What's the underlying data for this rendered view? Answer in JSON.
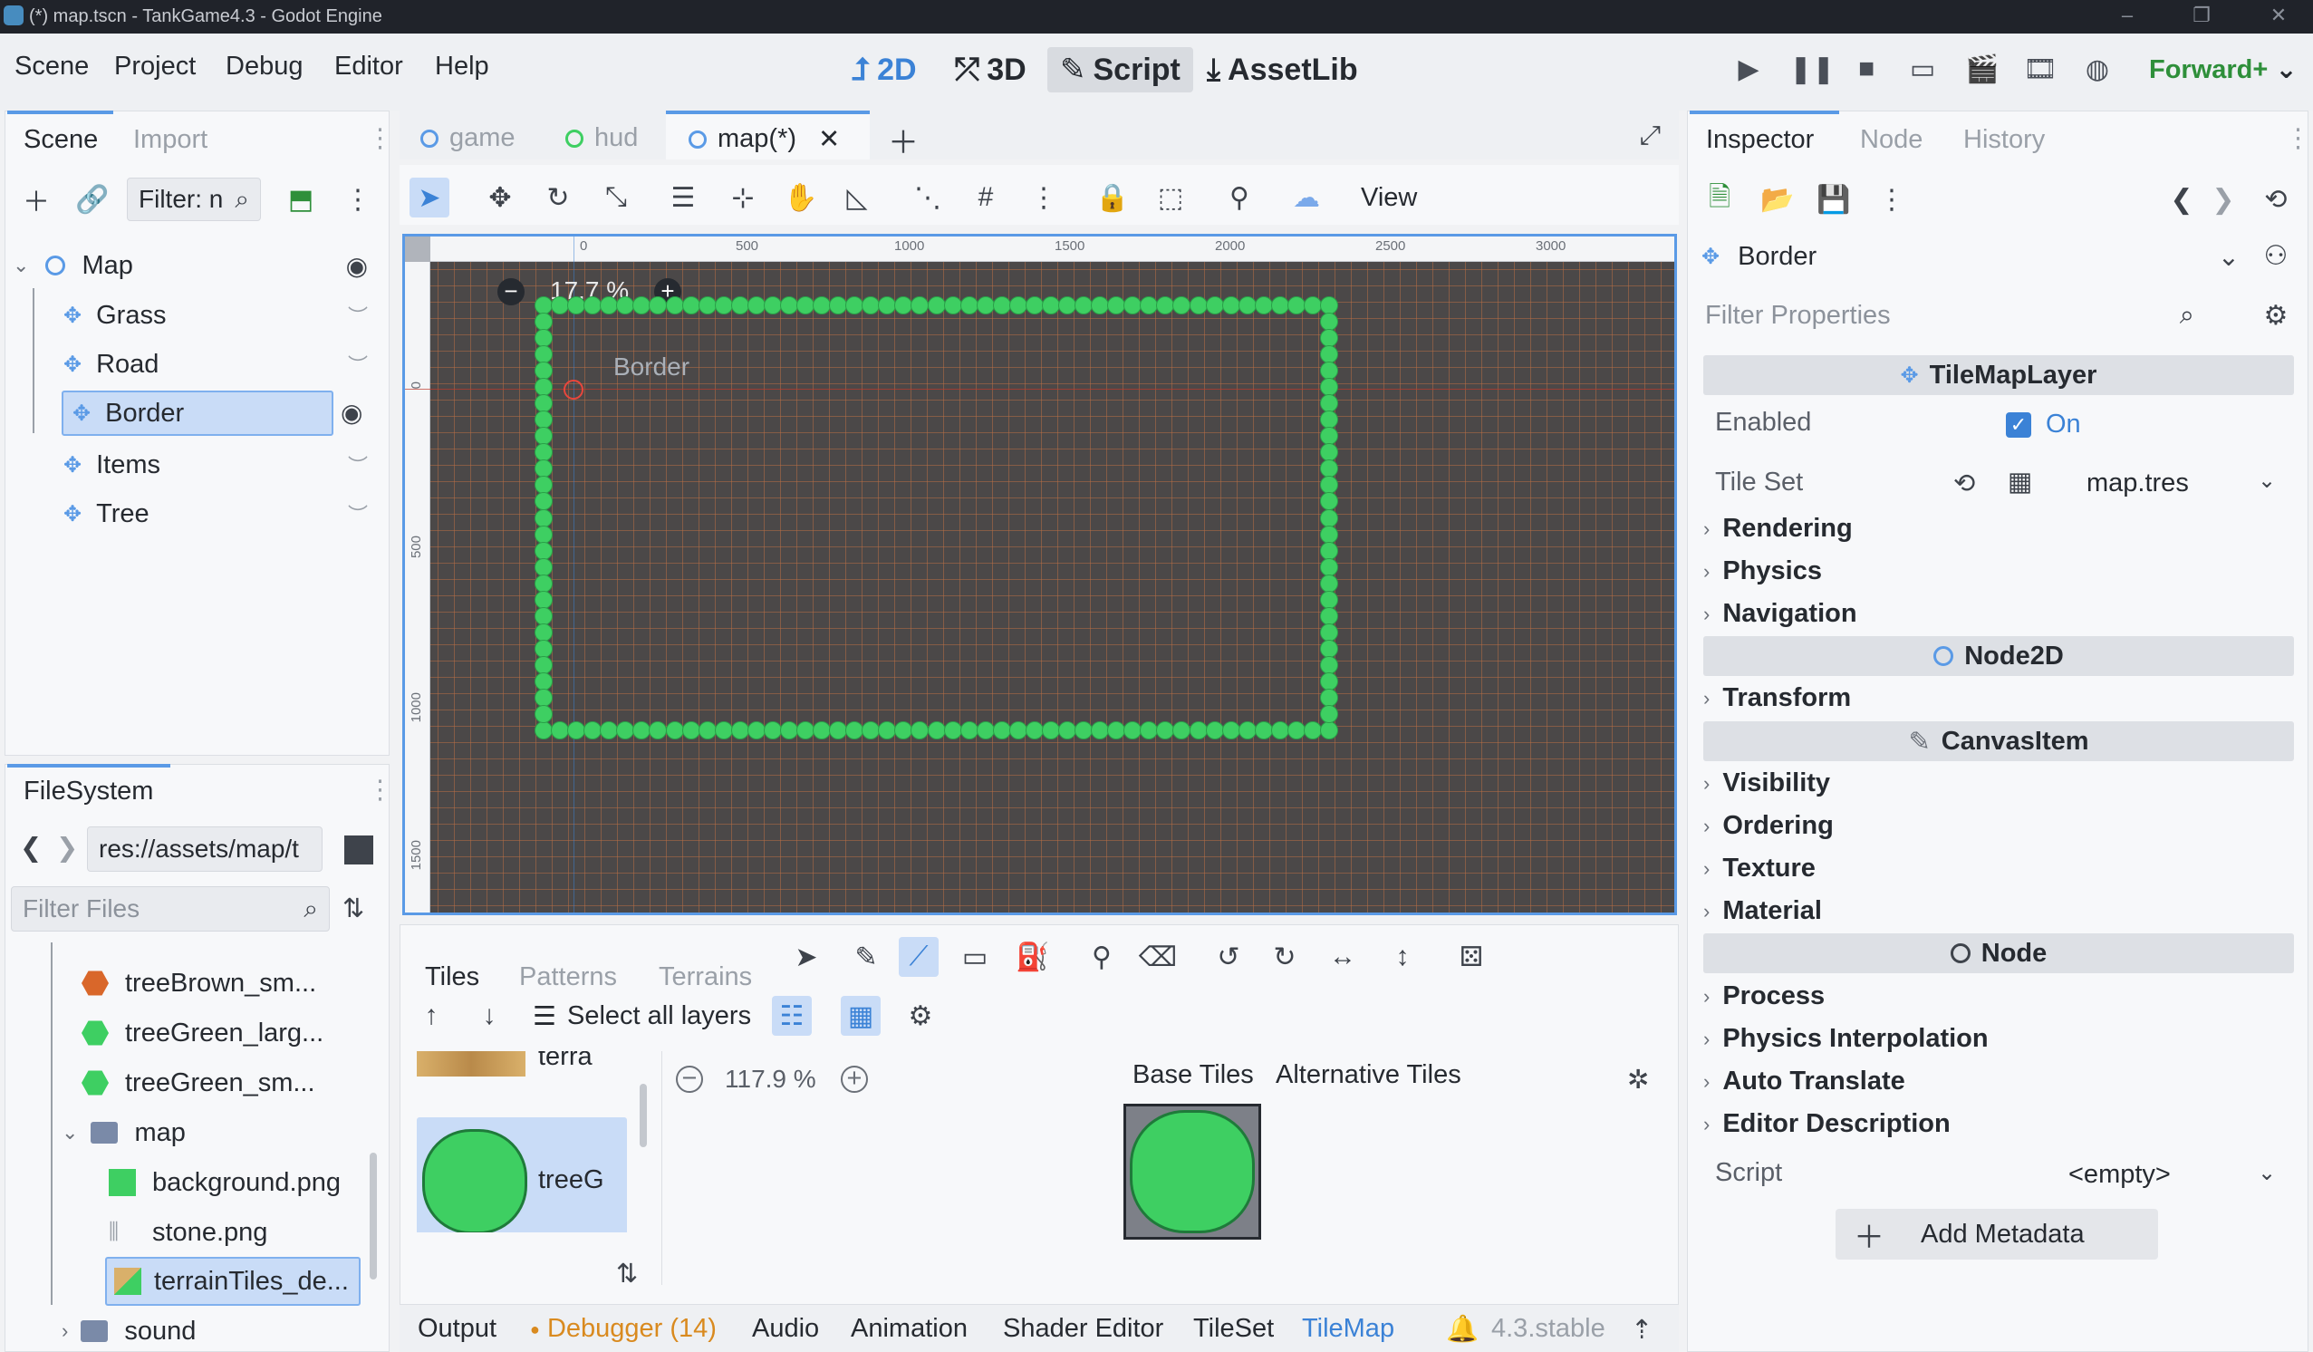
{
  "titlebar": {
    "title": "(*) map.tscn - TankGame4.3 - Godot Engine"
  },
  "menu": [
    "Scene",
    "Project",
    "Debug",
    "Editor",
    "Help"
  ],
  "workspaces": {
    "twod": "2D",
    "threed": "3D",
    "script": "Script",
    "assetlib": "AssetLib"
  },
  "renderer": "Forward+",
  "scene_panel": {
    "tabs": [
      "Scene",
      "Import"
    ],
    "filter_placeholder": "Filter: n",
    "tree": [
      {
        "label": "Map"
      },
      {
        "label": "Grass"
      },
      {
        "label": "Road"
      },
      {
        "label": "Border"
      },
      {
        "label": "Items"
      },
      {
        "label": "Tree"
      }
    ]
  },
  "filesystem": {
    "tab": "FileSystem",
    "path": "res://assets/map/t",
    "filter_placeholder": "Filter Files",
    "items": [
      {
        "label": "treeBrown_sm...",
        "color": "#d9672a"
      },
      {
        "label": "treeGreen_larg...",
        "color": "#3ecf62"
      },
      {
        "label": "treeGreen_sm...",
        "color": "#3ecf62"
      },
      {
        "label": "map"
      },
      {
        "label": "background.png",
        "color": "#3ecf62"
      },
      {
        "label": "stone.png"
      },
      {
        "label": "terrainTiles_de..."
      },
      {
        "label": "sound"
      }
    ]
  },
  "editor_tabs": [
    "game",
    "hud",
    "map(*)"
  ],
  "viewport": {
    "zoom": "17.7 %",
    "view_label": "View",
    "node_label": "Border",
    "ruler_h": [
      "0",
      "500",
      "1000",
      "1500",
      "2000",
      "2500",
      "3000"
    ],
    "ruler_v": [
      "0",
      "500",
      "1000",
      "1500"
    ]
  },
  "tilemap_panel": {
    "tabs": [
      "Tiles",
      "Patterns",
      "Terrains"
    ],
    "select_all_layers": "Select all layers",
    "sources": [
      {
        "label": "terra"
      },
      {
        "label": "treeG"
      }
    ],
    "zoom": "117.9 %",
    "base_tiles": "Base Tiles",
    "alt_tiles": "Alternative Tiles"
  },
  "bottom_tabs": [
    "Output",
    "Debugger (14)",
    "Audio",
    "Animation",
    "Shader Editor",
    "TileSet",
    "TileMap"
  ],
  "version": "4.3.stable",
  "inspector": {
    "tabs": [
      "Inspector",
      "Node",
      "History"
    ],
    "node_name": "Border",
    "filter_placeholder": "Filter Properties",
    "sections": {
      "tilemaplayer": "TileMapLayer",
      "node2d": "Node2D",
      "canvasitem": "CanvasItem",
      "node": "Node"
    },
    "enabled_label": "Enabled",
    "enabled_value": "On",
    "tileset_label": "Tile Set",
    "tileset_value": "map.tres",
    "groups_tilemaplayer": [
      "Rendering",
      "Physics",
      "Navigation"
    ],
    "groups_node2d": [
      "Transform"
    ],
    "groups_canvasitem": [
      "Visibility",
      "Ordering",
      "Texture",
      "Material"
    ],
    "groups_node": [
      "Process",
      "Physics Interpolation",
      "Auto Translate",
      "Editor Description"
    ],
    "script_label": "Script",
    "script_value": "<empty>",
    "add_metadata": "Add Metadata"
  },
  "colors": {
    "accent": "#5a9ae6",
    "tile_green": "#3ecf62",
    "renderer_green": "#2e8f3a",
    "debugger_orange": "#d98a1f"
  }
}
